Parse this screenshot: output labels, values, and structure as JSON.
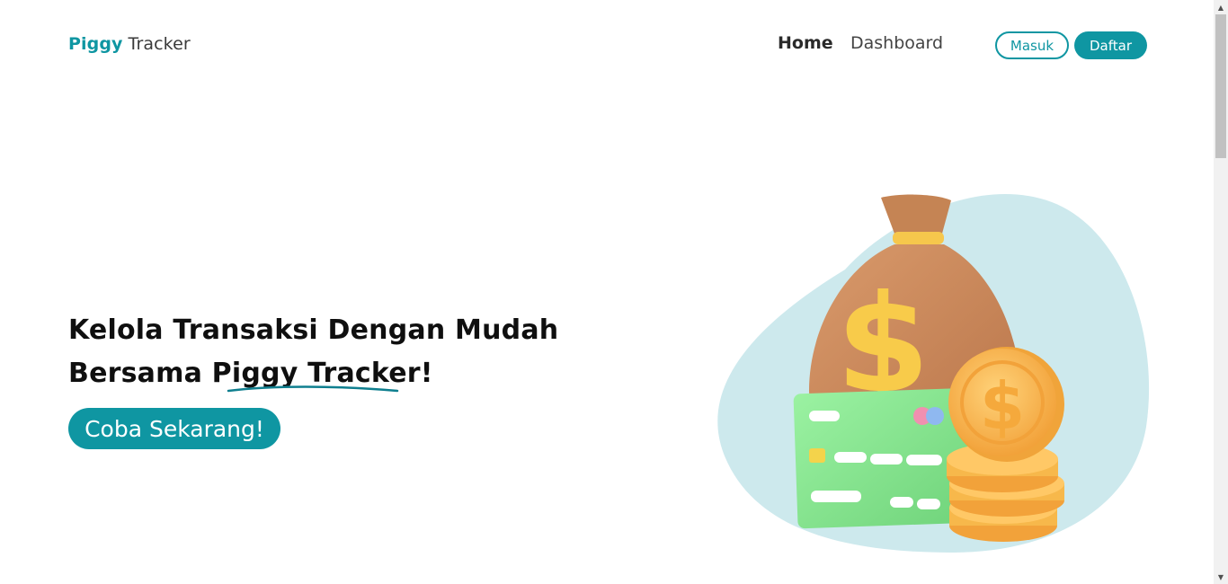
{
  "navbar": {
    "brand_bold": "Piggy",
    "brand_regular": "Tracker",
    "links": [
      "Home",
      "Dashboard"
    ],
    "login_label": "Masuk",
    "register_label": "Daftar"
  },
  "hero": {
    "line1": "Kelola Transaksi Dengan Mudah",
    "line2_prefix": "Bersama ",
    "line2_highlight": "Piggy Tracker",
    "line2_suffix": "!",
    "cta_label": "Coba Sekarang!"
  },
  "illustration": {
    "icon": "money-bag-card-coins-illustration",
    "colors": {
      "accent": "#0f96a2",
      "blob": "#cde9ed",
      "bag": "#c98a5e",
      "coin": "#f7b84b",
      "card": "#86e28f"
    }
  },
  "scrollbar": {
    "up_icon": "▲",
    "down_icon": "▼"
  }
}
